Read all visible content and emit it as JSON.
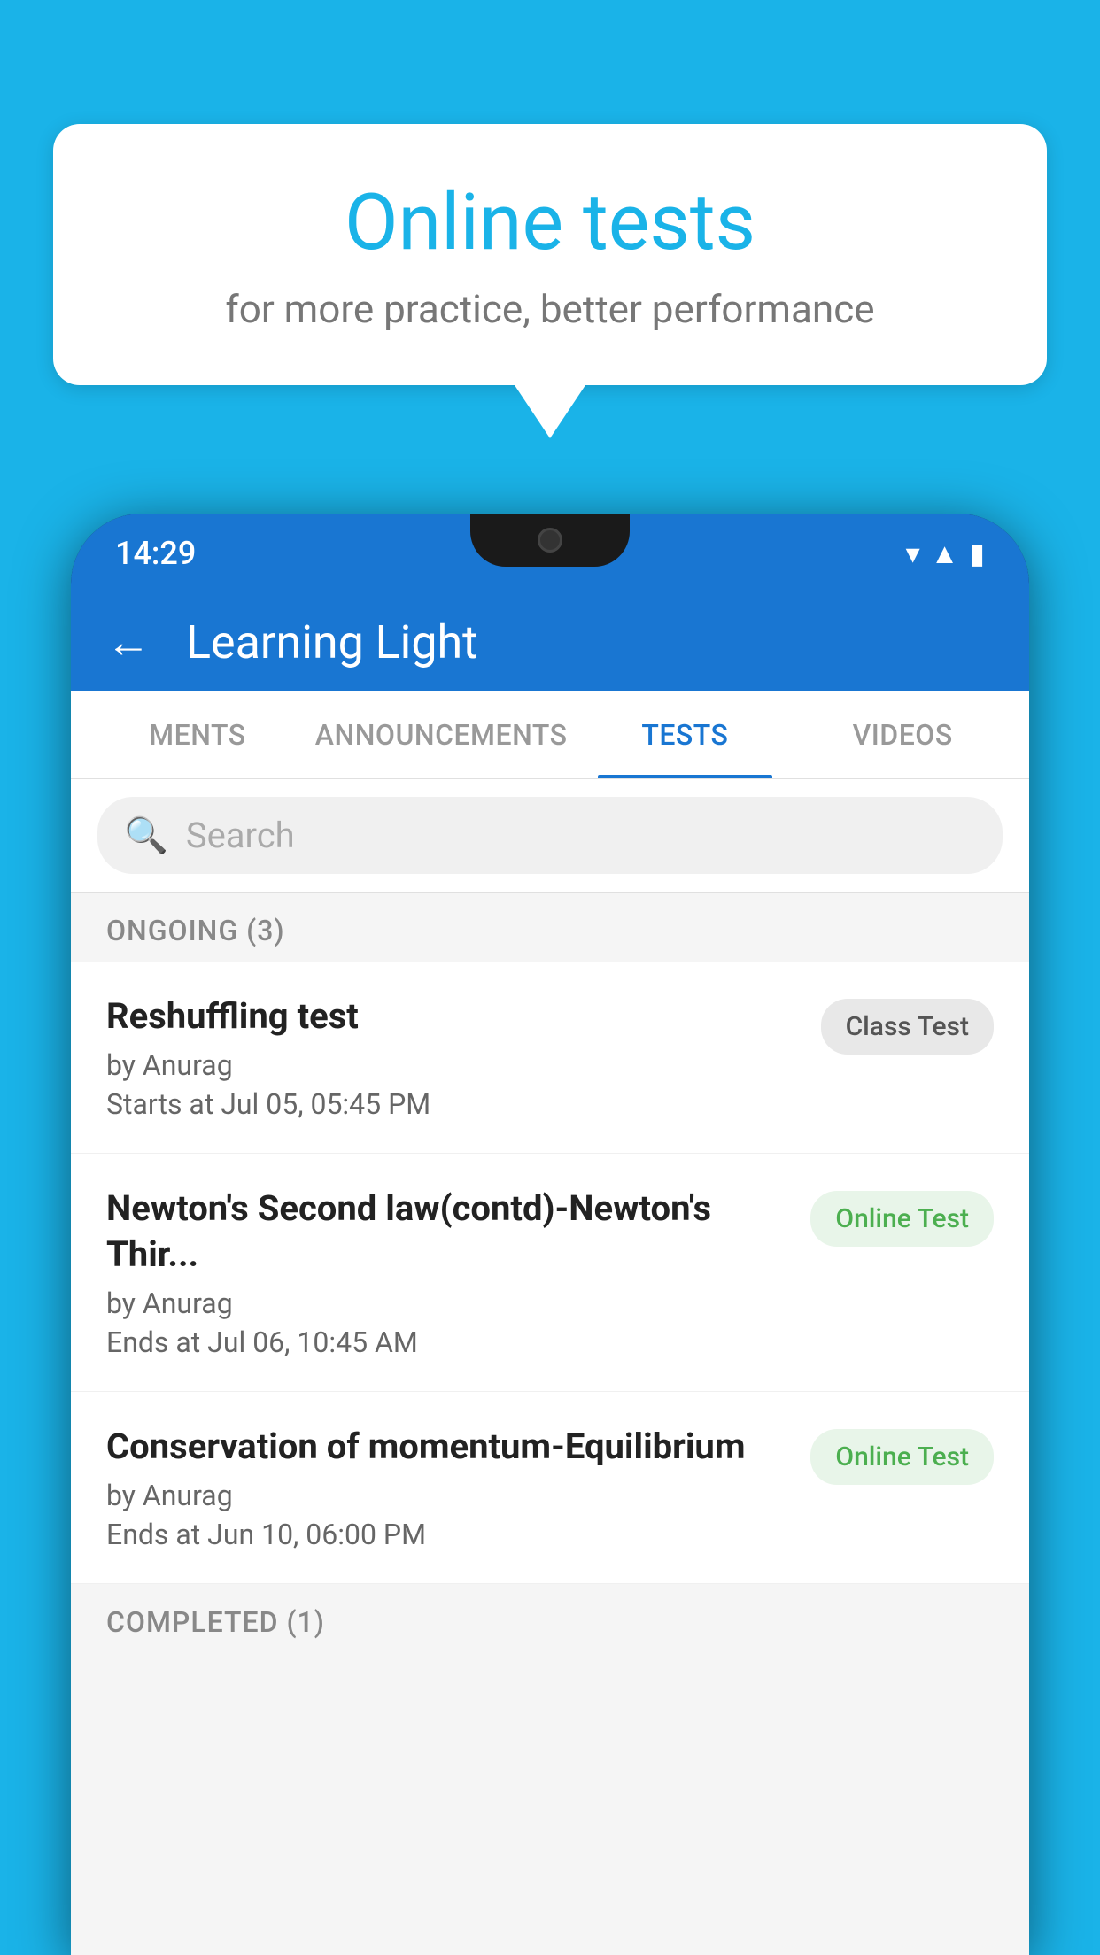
{
  "background_color": "#1ab3e8",
  "bubble": {
    "title": "Online tests",
    "subtitle": "for more practice, better performance"
  },
  "phone": {
    "status_time": "14:29",
    "app_title": "Learning Light",
    "back_label": "←",
    "tabs": [
      {
        "label": "MENTS",
        "active": false
      },
      {
        "label": "ANNOUNCEMENTS",
        "active": false
      },
      {
        "label": "TESTS",
        "active": true
      },
      {
        "label": "VIDEOS",
        "active": false
      }
    ],
    "search_placeholder": "Search",
    "section_ongoing": "ONGOING (3)",
    "section_completed": "COMPLETED (1)",
    "tests": [
      {
        "name": "Reshuffling test",
        "by": "by Anurag",
        "date": "Starts at  Jul 05, 05:45 PM",
        "badge": "Class Test",
        "badge_type": "class"
      },
      {
        "name": "Newton's Second law(contd)-Newton's Thir...",
        "by": "by Anurag",
        "date": "Ends at  Jul 06, 10:45 AM",
        "badge": "Online Test",
        "badge_type": "online"
      },
      {
        "name": "Conservation of momentum-Equilibrium",
        "by": "by Anurag",
        "date": "Ends at  Jun 10, 06:00 PM",
        "badge": "Online Test",
        "badge_type": "online"
      }
    ]
  }
}
